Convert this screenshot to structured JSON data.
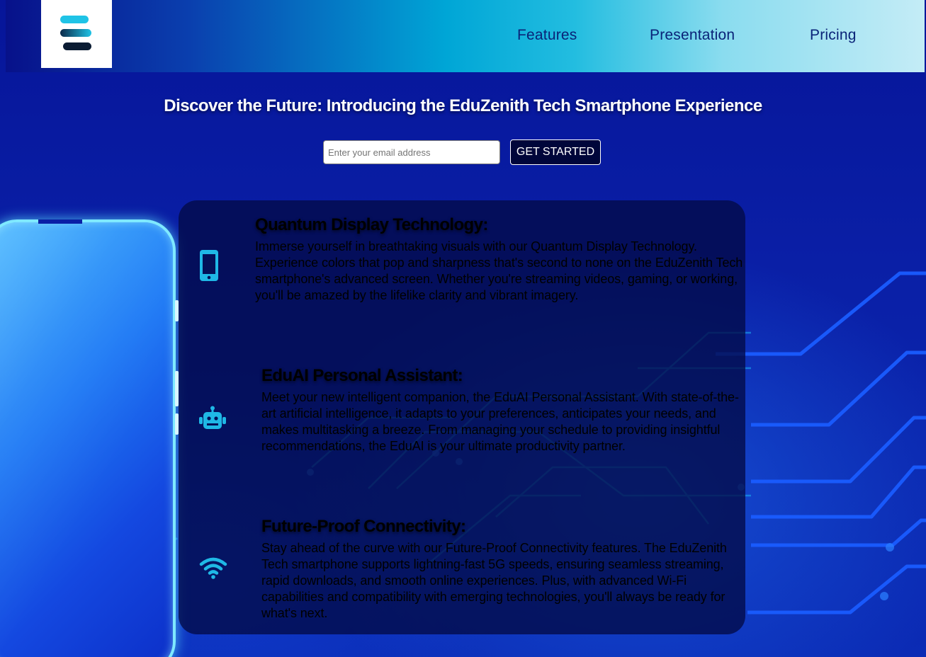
{
  "header": {
    "logo_alt": "EduZenith Tech logo",
    "nav": [
      {
        "label": "Features"
      },
      {
        "label": "Presentation"
      },
      {
        "label": "Pricing"
      }
    ]
  },
  "hero": {
    "title": "Discover the Future: Introducing the EduZenith Tech Smartphone Experience",
    "email_placeholder": "Enter your email address",
    "email_value": "",
    "cta_label": "GET STARTED"
  },
  "features": [
    {
      "icon": "smartphone-icon",
      "title": "Quantum Display Technology:",
      "text": "Immerse yourself in breathtaking visuals with our Quantum Display Technology. Experience colors that pop and sharpness that's second to none on the EduZenith Tech smartphone's advanced screen. Whether you're streaming videos, gaming, or working, you'll be amazed by the lifelike clarity and vibrant imagery."
    },
    {
      "icon": "robot-icon",
      "title": "EduAI Personal Assistant:",
      "text": "Meet your new intelligent companion, the EduAI Personal Assistant. With state-of-the-art artificial intelligence, it adapts to your preferences, anticipates your needs, and makes multitasking a breeze. From managing your schedule to providing insightful recommendations, the EduAI is your ultimate productivity partner."
    },
    {
      "icon": "wifi-icon",
      "title": "Future-Proof Connectivity:",
      "text": "Stay ahead of the curve with our Future-Proof Connectivity features. The EduZenith Tech smartphone supports lightning-fast 5G speeds, ensuring seamless streaming, rapid downloads, and smooth online experiences. Plus, with advanced Wi-Fi capabilities and compatibility with emerging technologies, you'll always be ready for what's next."
    }
  ],
  "colors": {
    "background": "#05189a",
    "panel": "#020a46",
    "icon_accent": "#1fb8e6",
    "nav_text": "#0a2378",
    "phone_glow": "#7fe9ff"
  }
}
